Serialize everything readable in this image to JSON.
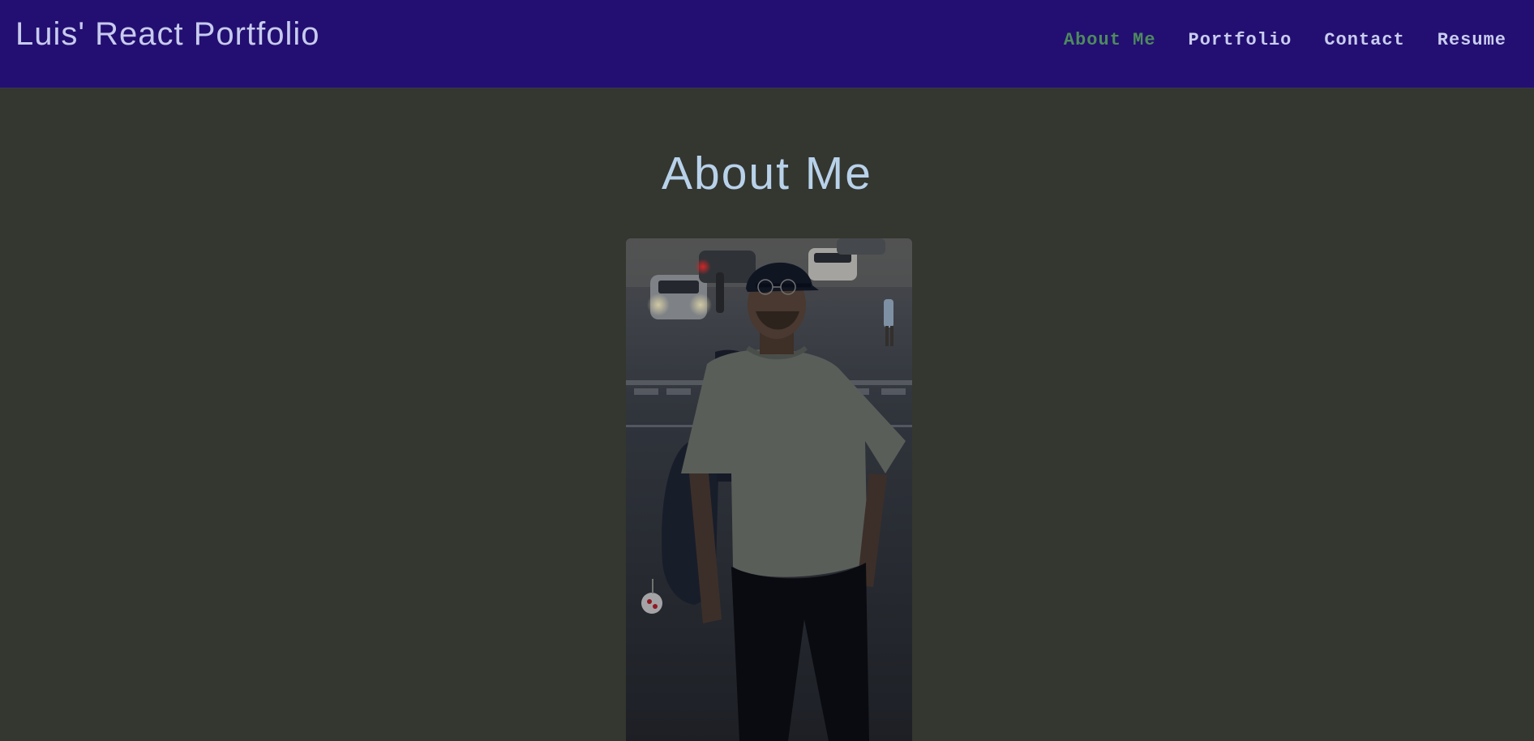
{
  "header": {
    "brand": "Luis' React Portfolio",
    "nav": [
      {
        "label": "About Me",
        "active": true
      },
      {
        "label": "Portfolio",
        "active": false
      },
      {
        "label": "Contact",
        "active": false
      },
      {
        "label": "Resume",
        "active": false
      }
    ]
  },
  "main": {
    "title": "About Me",
    "photo": {
      "subject": "portrait-photo"
    }
  },
  "colors": {
    "header_bg": "#230f71",
    "page_bg": "#343630",
    "nav_text": "#c9cdf0",
    "nav_active": "#4e8a5e",
    "title_text": "#b8d2ea"
  }
}
